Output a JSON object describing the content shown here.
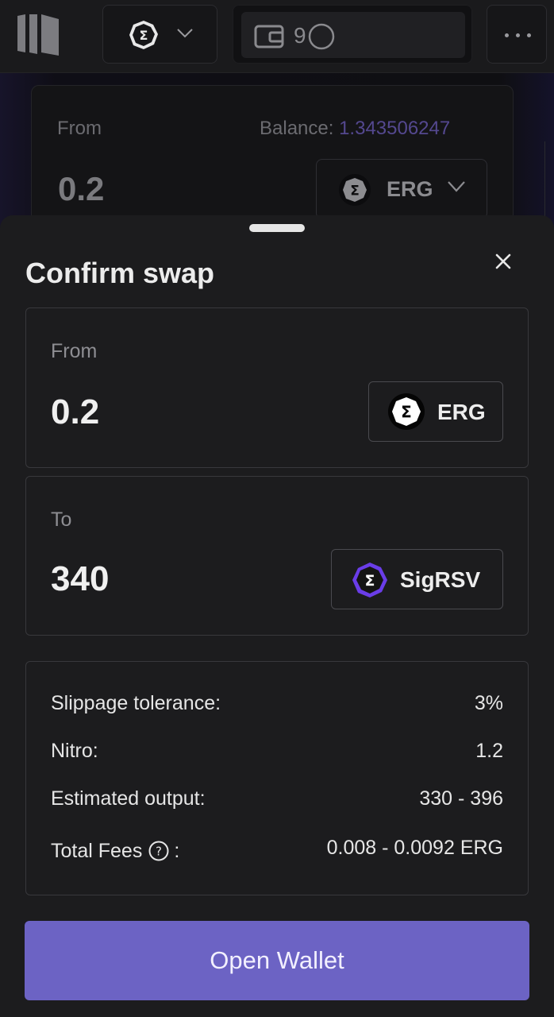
{
  "header": {
    "network_icon": "ergo-sigma-icon",
    "wallet_icon": "wallet-icon",
    "wallet_text": "9",
    "menu_icon": "more-dots-icon"
  },
  "background_swap": {
    "from_label": "From",
    "balance_label": "Balance:",
    "balance_value": "1.343506247",
    "amount": "0.2",
    "token": "ERG"
  },
  "sheet": {
    "title": "Confirm swap",
    "close_icon": "close-icon",
    "from": {
      "label": "From",
      "amount": "0.2",
      "token": "ERG",
      "token_icon": "ergo-sigma-icon"
    },
    "to": {
      "label": "To",
      "amount": "340",
      "token": "SigRSV",
      "token_icon": "sigrsv-sigma-icon"
    },
    "details": {
      "slippage_label": "Slippage tolerance:",
      "slippage_value": "3%",
      "nitro_label": "Nitro:",
      "nitro_value": "1.2",
      "estimated_label": "Estimated output:",
      "estimated_value": "330 - 396",
      "fees_label": "Total Fees",
      "fees_suffix": ":",
      "fees_value": "0.008 - 0.0092 ERG",
      "help_icon": "question-circle-icon"
    },
    "cta_label": "Open Wallet"
  },
  "colors": {
    "accent": "#6c63c4",
    "balance_value": "#54488f",
    "sheet_bg": "#1c1c1e",
    "sigrsv_ring": "#6a3de8"
  }
}
